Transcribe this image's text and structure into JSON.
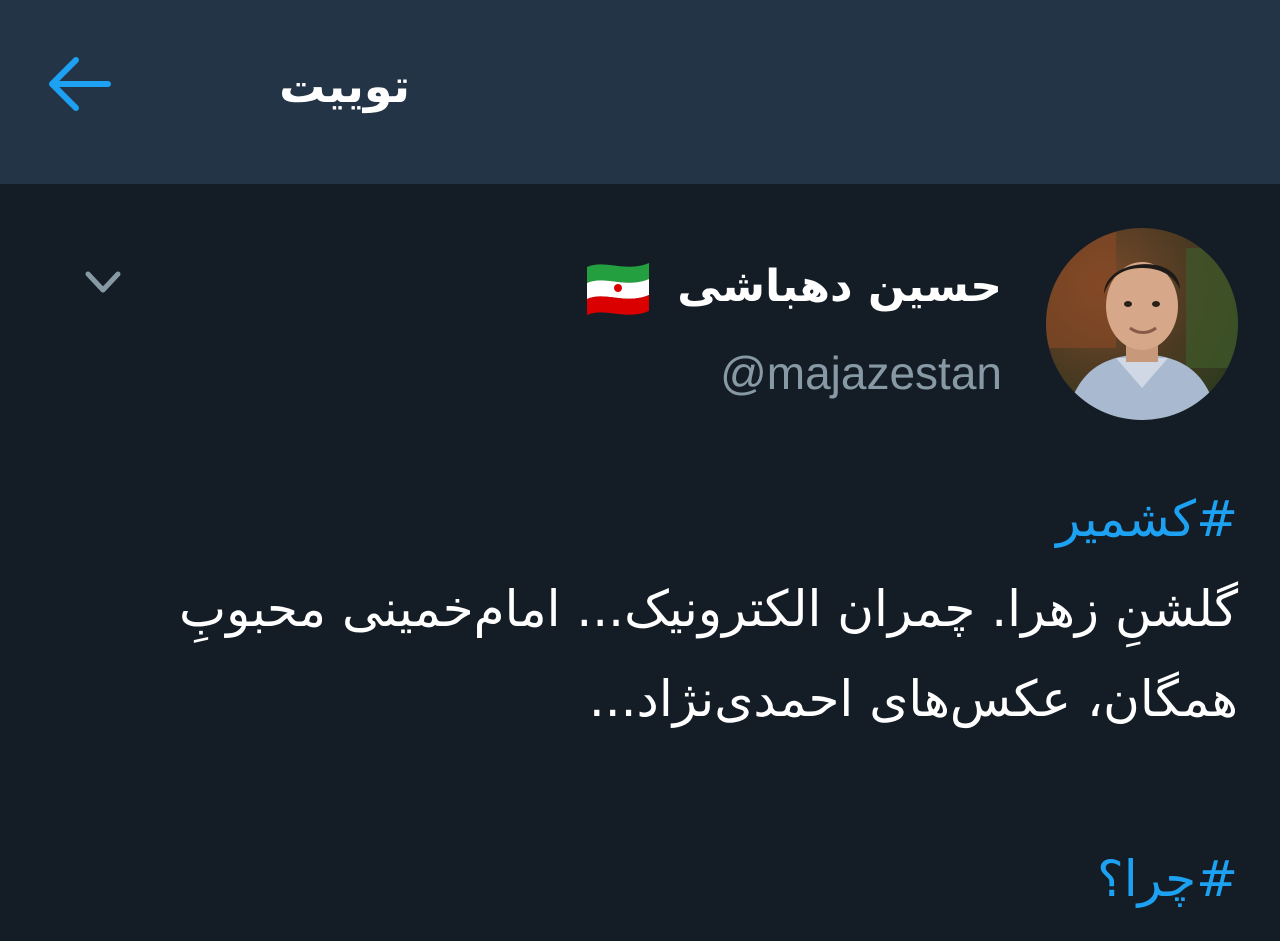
{
  "header": {
    "title": "توییت",
    "back_icon": "arrow-left-icon",
    "accent_color": "#1da1f2"
  },
  "tweet": {
    "author": {
      "display_name": "حسین دهباشی",
      "flag_icon": "iran-flag-icon",
      "handle": "@majazestan"
    },
    "menu_icon": "chevron-down-icon",
    "hashtag_1": "#کشمیر",
    "text": "گلشنِ زهرا. چمران الکترونیک... امام‌خمینی محبوبِ همگان، عکس‌های احمدی‌نژاد...",
    "hashtag_2": "#چرا؟"
  }
}
